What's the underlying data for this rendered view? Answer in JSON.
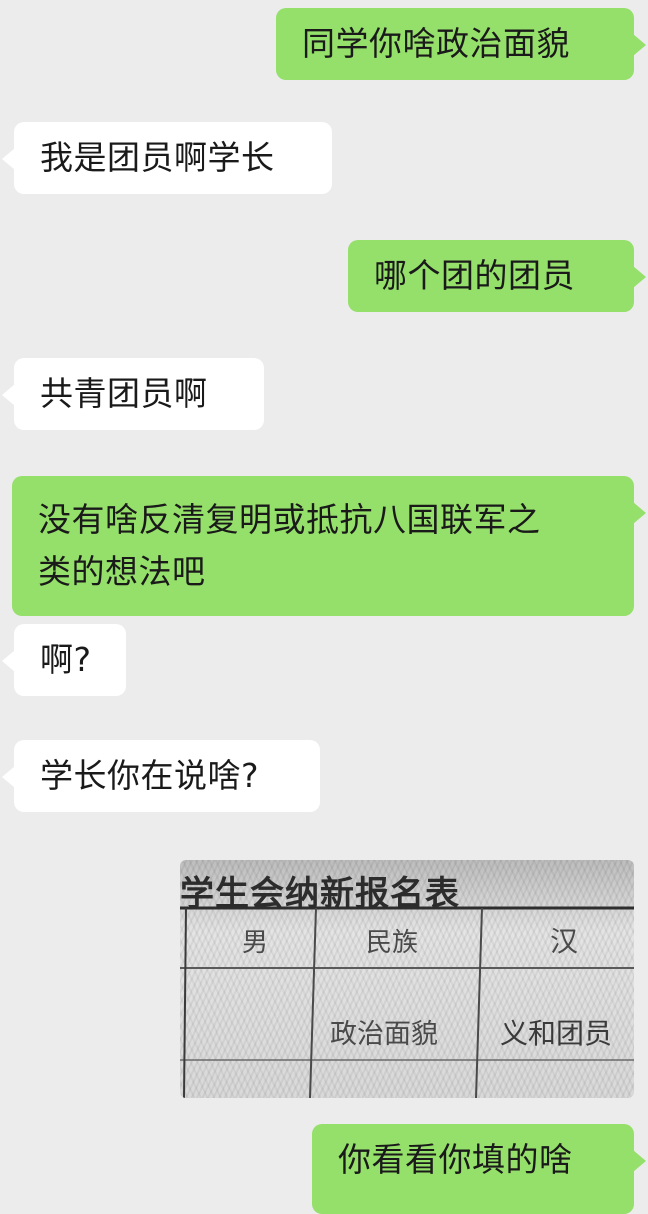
{
  "messages": [
    {
      "side": "out",
      "text": "同学你啥政治面貌"
    },
    {
      "side": "in",
      "text": "我是团员啊学长"
    },
    {
      "side": "out",
      "text": "哪个团的团员"
    },
    {
      "side": "in",
      "text": "共青团员啊"
    },
    {
      "side": "out",
      "line1": "没有啥反清复明或抵抗八国联军之",
      "line2": "类的想法吧"
    },
    {
      "side": "in",
      "text": "啊?"
    },
    {
      "side": "in",
      "text": "学长你在说啥?"
    },
    {
      "side": "out",
      "type": "image"
    },
    {
      "side": "out",
      "text": "你看看你填的啥"
    }
  ],
  "form_photo": {
    "title": "学生会纳新报名表",
    "gender_value": "男",
    "ethnicity_label": "民族",
    "ethnicity_value": "汉",
    "political_label": "政治面貌",
    "political_value": "义和团员"
  },
  "colors": {
    "background": "#ececec",
    "outgoing_bubble": "#95e06a",
    "incoming_bubble": "#ffffff"
  }
}
